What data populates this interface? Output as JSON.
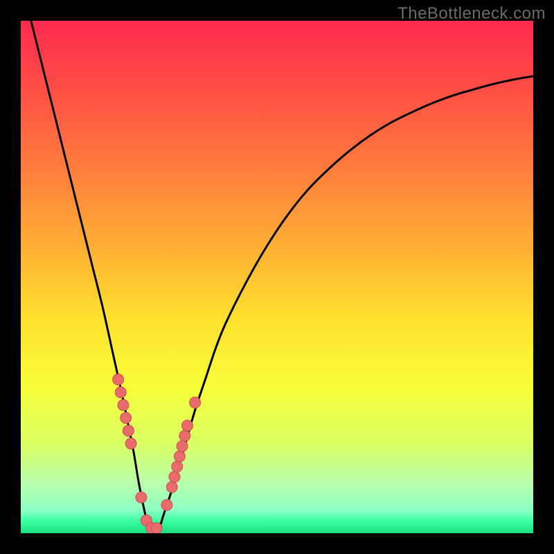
{
  "watermark": "TheBottleneck.com",
  "colors": {
    "frame": "#000000",
    "curve": "#000000",
    "dot_fill": "#e86c6c",
    "dot_stroke": "#c94f4f",
    "gradient_stops": [
      {
        "offset": 0.0,
        "color": "#ff2a4e"
      },
      {
        "offset": 0.12,
        "color": "#ff4a46"
      },
      {
        "offset": 0.28,
        "color": "#ff7a3d"
      },
      {
        "offset": 0.44,
        "color": "#ffae34"
      },
      {
        "offset": 0.58,
        "color": "#ffe02e"
      },
      {
        "offset": 0.72,
        "color": "#f7ff3a"
      },
      {
        "offset": 0.83,
        "color": "#d7ff66"
      },
      {
        "offset": 0.9,
        "color": "#baffaa"
      },
      {
        "offset": 0.955,
        "color": "#8effc4"
      },
      {
        "offset": 0.975,
        "color": "#3fffa4"
      },
      {
        "offset": 1.0,
        "color": "#18e07c"
      }
    ]
  },
  "chart_data": {
    "type": "line",
    "title": "",
    "xlabel": "",
    "ylabel": "",
    "xlim": [
      0,
      100
    ],
    "ylim": [
      0,
      100
    ],
    "note": "V-shaped bottleneck curve. x is a normalized hardware-balance axis (0–100); y is bottleneck percentage (0 = balanced/green, 100 = maximally bottlenecked/red). Values estimated from pixel positions.",
    "series": [
      {
        "name": "bottleneck-curve",
        "x": [
          2,
          4,
          6,
          8,
          10,
          12,
          14,
          16,
          18,
          20,
          21,
          22,
          23,
          24,
          25,
          26,
          27,
          28,
          30,
          32,
          34,
          36,
          38,
          40,
          44,
          48,
          52,
          56,
          60,
          64,
          68,
          72,
          76,
          80,
          84,
          88,
          92,
          96,
          100
        ],
        "y": [
          100,
          92,
          84,
          76,
          68,
          60,
          52,
          44,
          35,
          26,
          21,
          16,
          10,
          5,
          1,
          0,
          1,
          4,
          10,
          17,
          24,
          30,
          36,
          41,
          49,
          56,
          62,
          67,
          71,
          74.5,
          77.5,
          80,
          82,
          83.8,
          85.3,
          86.5,
          87.6,
          88.5,
          89.2
        ]
      }
    ],
    "points": {
      "name": "sample-dots",
      "note": "Two clusters of pink dots near the valley of the V, estimated coordinates.",
      "x": [
        19.0,
        19.5,
        20.0,
        20.5,
        21.0,
        21.5,
        23.5,
        24.5,
        25.5,
        26.5,
        28.5,
        29.5,
        30.0,
        30.5,
        31.0,
        31.5,
        32.0,
        32.5,
        34.0
      ],
      "y": [
        30.0,
        27.5,
        25.0,
        22.5,
        20.0,
        17.5,
        7.0,
        2.5,
        1.0,
        1.0,
        5.5,
        9.0,
        11.0,
        13.0,
        15.0,
        17.0,
        19.0,
        21.0,
        25.5
      ]
    }
  }
}
